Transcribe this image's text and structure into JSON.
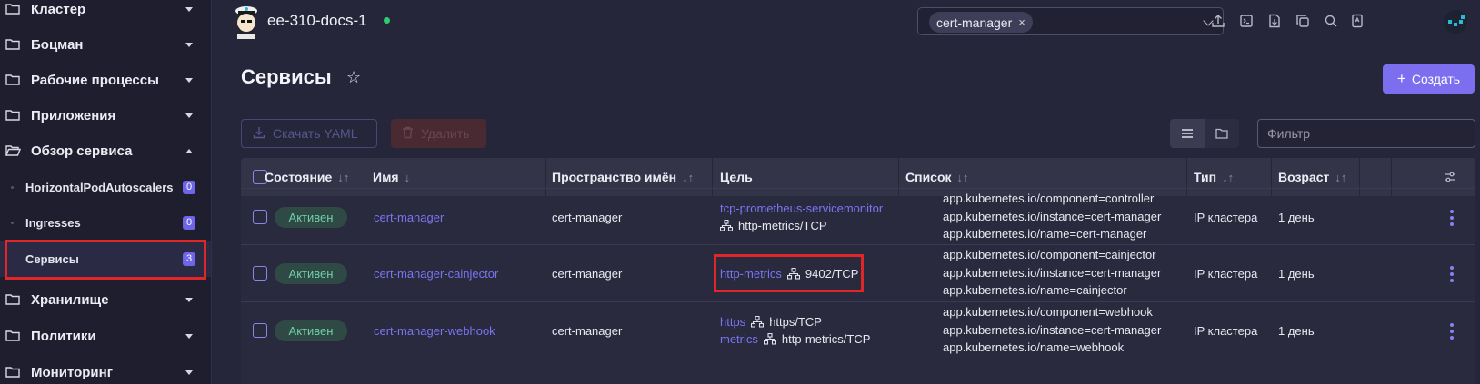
{
  "sidebar": {
    "items": [
      {
        "label": "Кластер"
      },
      {
        "label": "Боцман"
      },
      {
        "label": "Рабочие процессы"
      },
      {
        "label": "Приложения"
      },
      {
        "label": "Обзор сервиса"
      },
      {
        "label": "Хранилище"
      },
      {
        "label": "Политики"
      },
      {
        "label": "Мониторинг"
      }
    ],
    "sub_items": [
      {
        "label": "HorizontalPodAutoscalers",
        "count": "0"
      },
      {
        "label": "Ingresses",
        "count": "0"
      },
      {
        "label": "Сервисы",
        "count": "3"
      }
    ]
  },
  "topbar": {
    "cluster_name": "ee-310-docs-1",
    "namespace_chip": "cert-manager",
    "chip_close": "×"
  },
  "page": {
    "title": "Сервисы",
    "star": "☆",
    "create_label": "Создать",
    "create_plus": "+"
  },
  "toolbar": {
    "download_yaml": "Скачать YAML",
    "delete": "Удалить",
    "filter_placeholder": "Фильтр"
  },
  "table": {
    "headers": {
      "state": "Состояние",
      "name": "Имя",
      "namespace": "Пространство имён",
      "target": "Цель",
      "labels": "Список",
      "type": "Тип",
      "age": "Возраст"
    },
    "sort_both": "↓↑",
    "sort_down": "↓",
    "rows": [
      {
        "state": "Активен",
        "name": "cert-manager",
        "namespace": "cert-manager",
        "targets": [
          {
            "link": "tcp-prometheus-servicemonitor",
            "port": ""
          },
          {
            "link": "",
            "port": "http-metrics/TCP"
          }
        ],
        "labels": [
          "app.kubernetes.io/component=controller",
          "app.kubernetes.io/instance=cert-manager",
          "app.kubernetes.io/name=cert-manager"
        ],
        "type": "IP кластера",
        "age": "1 день"
      },
      {
        "state": "Активен",
        "name": "cert-manager-cainjector",
        "namespace": "cert-manager",
        "targets": [
          {
            "link": "http-metrics",
            "port": "9402/TCP"
          }
        ],
        "labels": [
          "app.kubernetes.io/component=cainjector",
          "app.kubernetes.io/instance=cert-manager",
          "app.kubernetes.io/name=cainjector"
        ],
        "type": "IP кластера",
        "age": "1 день"
      },
      {
        "state": "Активен",
        "name": "cert-manager-webhook",
        "namespace": "cert-manager",
        "targets": [
          {
            "link": "https",
            "port": "https/TCP"
          },
          {
            "link": "metrics",
            "port": "http-metrics/TCP"
          }
        ],
        "labels": [
          "app.kubernetes.io/component=webhook",
          "app.kubernetes.io/instance=cert-manager",
          "app.kubernetes.io/name=webhook"
        ],
        "type": "IP кластера",
        "age": "1 день"
      }
    ]
  },
  "colors": {
    "accent": "#7b6ff0",
    "highlight": "#e02626",
    "status_active": "#6fcfa8"
  }
}
